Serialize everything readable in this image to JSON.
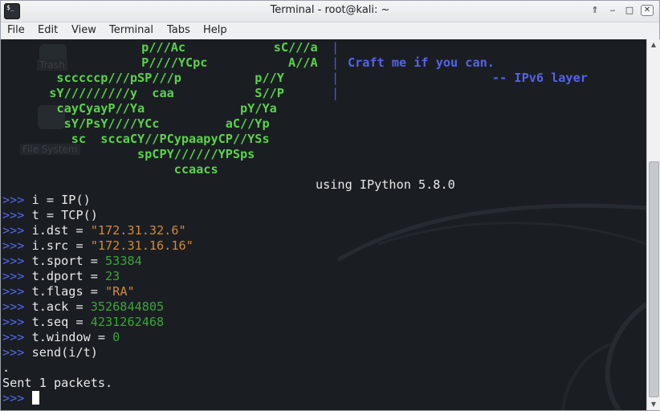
{
  "window": {
    "title": "Terminal - root@kali: ~",
    "icon_text": "$_",
    "buttons": {
      "keep_above": "⇑",
      "minimize": "‒",
      "maximize": "□",
      "close": "✕"
    }
  },
  "menu": [
    "File",
    "Edit",
    "View",
    "Terminal",
    "Tabs",
    "Help"
  ],
  "desktop_icons": [
    "Trash",
    "File System"
  ],
  "banner_art": [
    "        p///Ac            sC///a   ",
    "        P////YCpc           A//A   ",
    "   scccccp///pSP///p          p//Y   ",
    "  sY/////////y  caa           S//P   ",
    "   cayCyayP//Ya             pY/Ya",
    "    sY/PsY////YCc         aC//Yp",
    "     sc  sccaCY//PCypaapyCP//YSs",
    "              spCPY//////YPSps",
    "                   ccaacs"
  ],
  "banner_side": {
    "line1": "Craft me if you can.",
    "line2": "-- IPv6 layer",
    "separator": "|"
  },
  "using_line": "using IPython 5.8.0",
  "prompt": ">>>",
  "session": [
    {
      "code": " i = IP()"
    },
    {
      "code": " t = TCP()"
    },
    {
      "code": " i.dst = ",
      "string": "\"172.31.32.6\""
    },
    {
      "code": " i.src = ",
      "string": "\"172.31.16.16\""
    },
    {
      "code": " t.sport = ",
      "number": "53384"
    },
    {
      "code": " t.dport = ",
      "number": "23"
    },
    {
      "code": " t.flags = ",
      "string": "\"RA\""
    },
    {
      "code": " t.ack = ",
      "number": "3526844805"
    },
    {
      "code": " t.seq = ",
      "number": "4231262468"
    },
    {
      "code": " t.window = ",
      "number": "0"
    },
    {
      "code": " send(i/t)"
    }
  ],
  "output": [
    ".",
    "Sent 1 packets."
  ],
  "colors": {
    "terminal_bg": "#1a1e23",
    "ascii_art": "#5bd34a",
    "prompt": "#5567e8",
    "string_literal": "#d08a3c",
    "number_literal": "#3fa33a"
  }
}
